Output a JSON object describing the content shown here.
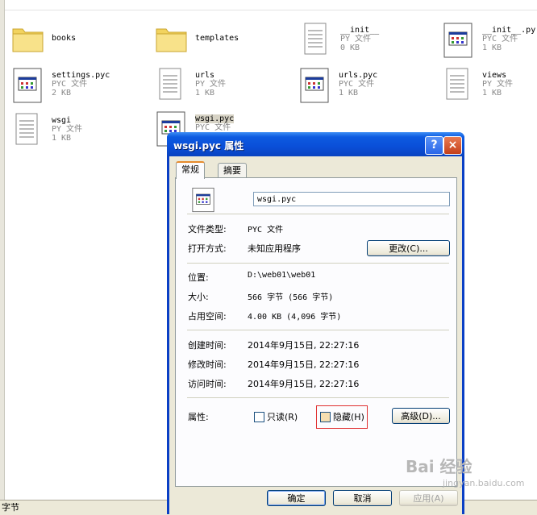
{
  "files": [
    {
      "name": "books",
      "type": "",
      "size": "",
      "icon": "folder-icon"
    },
    {
      "name": "templates",
      "type": "",
      "size": "",
      "icon": "folder-icon"
    },
    {
      "name": "__init__",
      "type": "PY 文件",
      "size": "0 KB",
      "icon": "py-file-icon"
    },
    {
      "name": "__init__.py",
      "type": "PYC 文件",
      "size": "1 KB",
      "icon": "pyc-file-icon"
    },
    {
      "name": "settings.pyc",
      "type": "PYC 文件",
      "size": "2 KB",
      "icon": "pyc-file-icon"
    },
    {
      "name": "urls",
      "type": "PY 文件",
      "size": "1 KB",
      "icon": "py-file-icon"
    },
    {
      "name": "urls.pyc",
      "type": "PYC 文件",
      "size": "1 KB",
      "icon": "pyc-file-icon"
    },
    {
      "name": "views",
      "type": "PY 文件",
      "size": "1 KB",
      "icon": "py-file-icon"
    },
    {
      "name": "wsgi",
      "type": "PY 文件",
      "size": "1 KB",
      "icon": "py-file-icon"
    },
    {
      "name": "wsgi.pyc",
      "type": "PYC 文件",
      "size": "",
      "icon": "pyc-file-icon"
    }
  ],
  "statusbar": {
    "text": "字节"
  },
  "dialog": {
    "title": "wsgi.pyc 属性",
    "help_label": "?",
    "close_label": "×",
    "tabs": [
      {
        "label": "常规"
      },
      {
        "label": "摘要"
      }
    ],
    "filename": "wsgi.pyc",
    "file_type_label": "文件类型:",
    "file_type_value": "PYC 文件",
    "open_with_label": "打开方式:",
    "open_with_value": "未知应用程序",
    "change_button": "更改(C)...",
    "location_label": "位置:",
    "location_value": "D:\\web01\\web01",
    "size_label": "大小:",
    "size_value": "566 字节 (566 字节)",
    "disk_size_label": "占用空间:",
    "disk_size_value": "4.00 KB (4,096 字节)",
    "created_label": "创建时间:",
    "created_value": "2014年9月15日, 22:27:16",
    "modified_label": "修改时间:",
    "modified_value": "2014年9月15日, 22:27:16",
    "accessed_label": "访问时间:",
    "accessed_value": "2014年9月15日, 22:27:16",
    "attributes_label": "属性:",
    "readonly_label": "只读(R)",
    "hidden_label": "隐藏(H)",
    "advanced_button": "高级(D)...",
    "ok_button": "确定",
    "cancel_button": "取消",
    "apply_button": "应用(A)"
  },
  "watermark": {
    "brand": "Bai 经验",
    "url": "jingyan.baidu.com"
  },
  "colors": {
    "titlebar": "#0a4fd8",
    "dialog_bg": "#ece9d8",
    "highlight_box": "#e03030"
  }
}
